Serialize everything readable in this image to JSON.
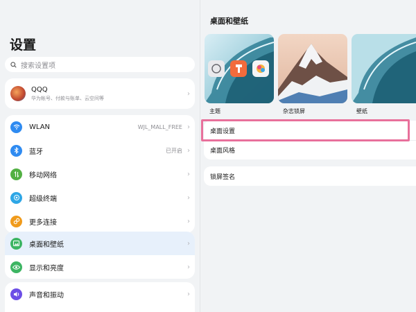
{
  "colors": {
    "accent": "#0a59f7",
    "selected_bg": "#e7f0fb",
    "highlight": "#e8709b",
    "wlan": "#2f8bf1",
    "bluetooth": "#2f8bf1",
    "mobile": "#52b043",
    "super": "#2fa7e6",
    "more": "#f09b1c",
    "desktop": "#3db563",
    "display": "#3db563",
    "sound": "#6c4ee6"
  },
  "sidebar": {
    "title": "设置",
    "search_placeholder": "搜索设置项",
    "account": {
      "name": "QQQ",
      "subtitle": "华为帐号、付款与账单、云空间等"
    },
    "group1": [
      {
        "label": "WLAN",
        "value": "WJL_MALL_FREE",
        "icon": "wifi-icon"
      },
      {
        "label": "蓝牙",
        "value": "已开启",
        "icon": "bluetooth-icon"
      },
      {
        "label": "移动网络",
        "value": "",
        "icon": "mobile-data-icon"
      },
      {
        "label": "超级终端",
        "value": "",
        "icon": "super-device-icon"
      },
      {
        "label": "更多连接",
        "value": "",
        "icon": "link-icon"
      }
    ],
    "group2": [
      {
        "label": "桌面和壁纸",
        "icon": "wallpaper-icon"
      },
      {
        "label": "显示和亮度",
        "icon": "eye-icon"
      }
    ],
    "group3": [
      {
        "label": "声音和振动",
        "icon": "speaker-icon"
      }
    ]
  },
  "detail": {
    "title": "桌面和壁纸",
    "thumbnails": [
      {
        "label": "主题"
      },
      {
        "label": "杂志锁屏"
      },
      {
        "label": "壁纸"
      }
    ],
    "settings_rows": [
      "桌面设置",
      "桌面风格"
    ],
    "lock_signature": "锁屏签名"
  }
}
